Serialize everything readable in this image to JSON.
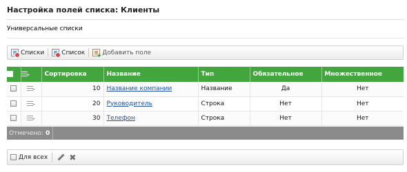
{
  "page": {
    "title": "Настройка полей списка: Клиенты",
    "breadcrumb": "Универсальные списки"
  },
  "toolbar": {
    "items": [
      {
        "label": "Списки",
        "icon": "list-icon"
      },
      {
        "label": "Список",
        "icon": "list-icon"
      },
      {
        "label": "Добавить поле",
        "icon": "add-field-icon"
      }
    ]
  },
  "table": {
    "headers": {
      "sort": "Сортировка",
      "name": "Название",
      "type": "Тип",
      "required": "Обязательное",
      "multiple": "Множественное"
    },
    "rows": [
      {
        "sort": "10",
        "name": "Название компании",
        "type": "Название",
        "required": "Да",
        "multiple": "Нет"
      },
      {
        "sort": "20",
        "name": "Руководитель",
        "type": "Строка",
        "required": "Нет",
        "multiple": "Нет"
      },
      {
        "sort": "30",
        "name": "Телефон",
        "type": "Строка",
        "required": "Нет",
        "multiple": "Нет"
      }
    ],
    "header_color": "#43a53d"
  },
  "footer": {
    "selected_label": "Отмечено:",
    "selected_count": "0"
  },
  "bottom_bar": {
    "for_all_label": "Для всех",
    "actions": [
      "pencil-icon",
      "delete-icon"
    ]
  }
}
